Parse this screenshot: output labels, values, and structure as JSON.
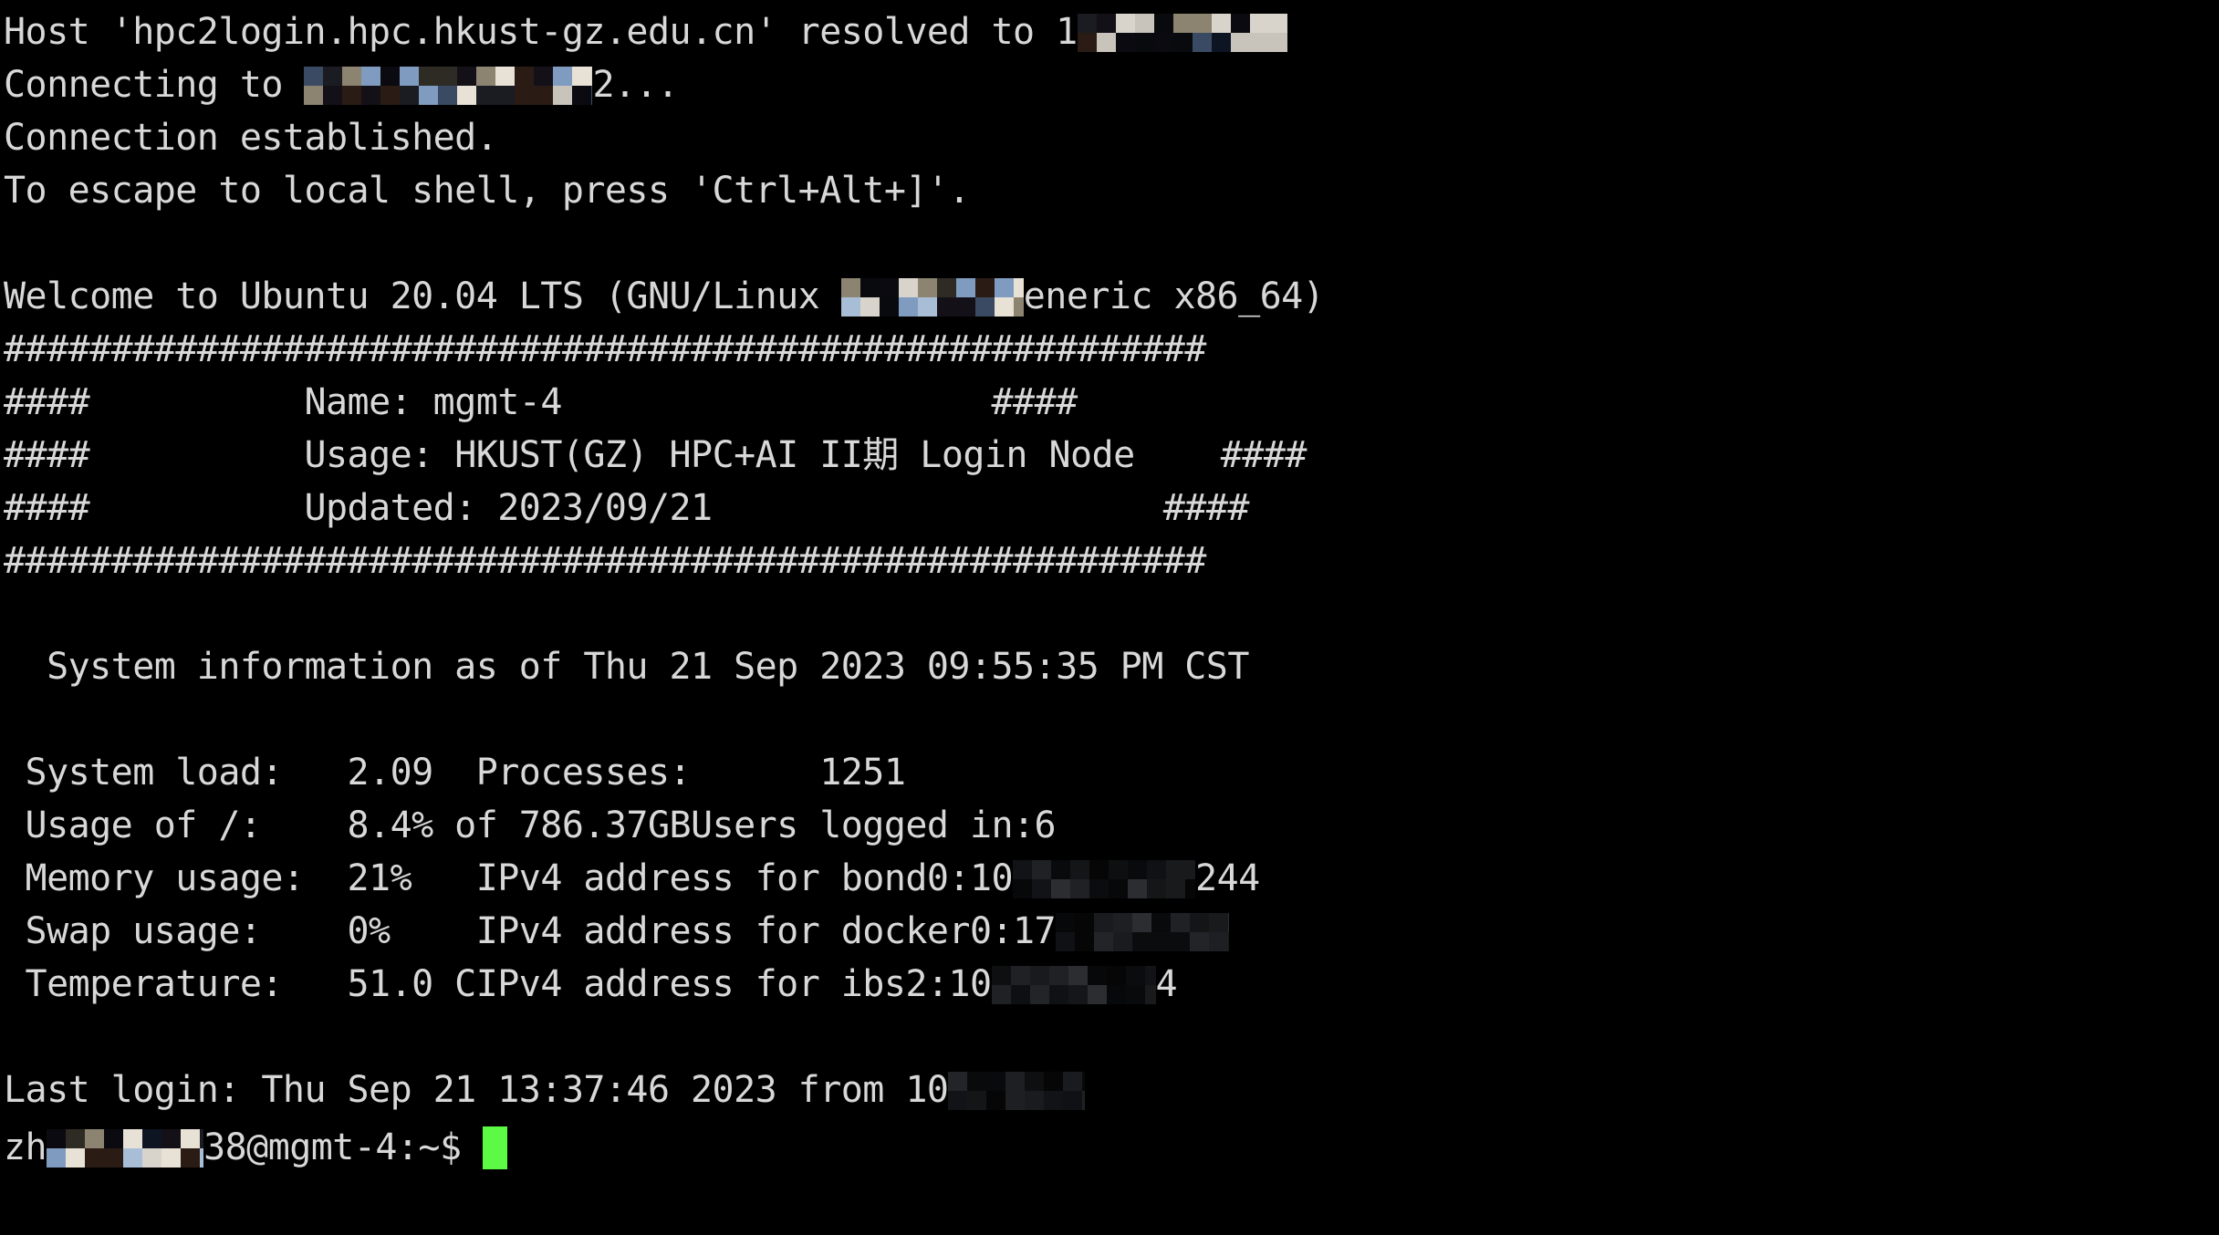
{
  "terminal": {
    "background_color": "#000000",
    "text_color": "#d8d8d8",
    "cursor_color": "#5cfa45",
    "font_size_px": 40,
    "line_height_px": 58
  },
  "lines": {
    "ssh_host_resolved_prefix": "Host 'hpc2login.hpc.hkust-gz.edu.cn' resolved to 1",
    "ssh_connecting_prefix": "Connecting to ",
    "ssh_connecting_suffix": "2...",
    "ssh_connection_established": "Connection established.",
    "ssh_escape_hint": "To escape to local shell, press 'Ctrl+Alt+]'.",
    "welcome_prefix": "Welcome to Ubuntu 20.04 LTS (GNU/Linux ",
    "welcome_suffix": "eneric x86_64)",
    "hash_rule": "########################################################",
    "banner_name_left": "####",
    "banner_name_label": "Name: mgmt-4",
    "banner_name_right": "####",
    "banner_usage_left": "####",
    "banner_usage_label": "Usage: HKUST(GZ) HPC+AI II期 Login Node",
    "banner_usage_right": "####",
    "banner_updated_left": "####",
    "banner_updated_label": "Updated: 2023/09/21",
    "banner_updated_right": "####",
    "sysinfo_header": "  System information as of Thu 21 Sep 2023 09:55:35 PM CST",
    "last_login_prefix": "Last login: Thu Sep 21 13:37:46 2023 from 1",
    "last_login_ip_head": "0",
    "prompt_user_head": "zh",
    "prompt_user_tail": "38",
    "prompt_rest": "@mgmt-4:~$ "
  },
  "sysinfo": {
    "left_column": [
      {
        "label": "System load:",
        "value": "2.09"
      },
      {
        "label": "Usage of /:",
        "value": "8.4% of 786.37GB"
      },
      {
        "label": "Memory usage:",
        "value": "21%"
      },
      {
        "label": "Swap usage:",
        "value": "0%"
      },
      {
        "label": "Temperature:",
        "value": "51.0 C"
      }
    ],
    "right_column": [
      {
        "label": "Processes:",
        "value": "1251",
        "redacted": false
      },
      {
        "label": "Users logged in:",
        "value": "6",
        "redacted": false
      },
      {
        "label": "IPv4 address for bond0:",
        "value": "10",
        "redacted": true,
        "tail": "244"
      },
      {
        "label": "IPv4 address for docker0:",
        "value": "17",
        "redacted": true,
        "tail": ""
      },
      {
        "label": "IPv4 address for ibs2:",
        "value": "10",
        "redacted": true,
        "tail": "4"
      }
    ]
  }
}
